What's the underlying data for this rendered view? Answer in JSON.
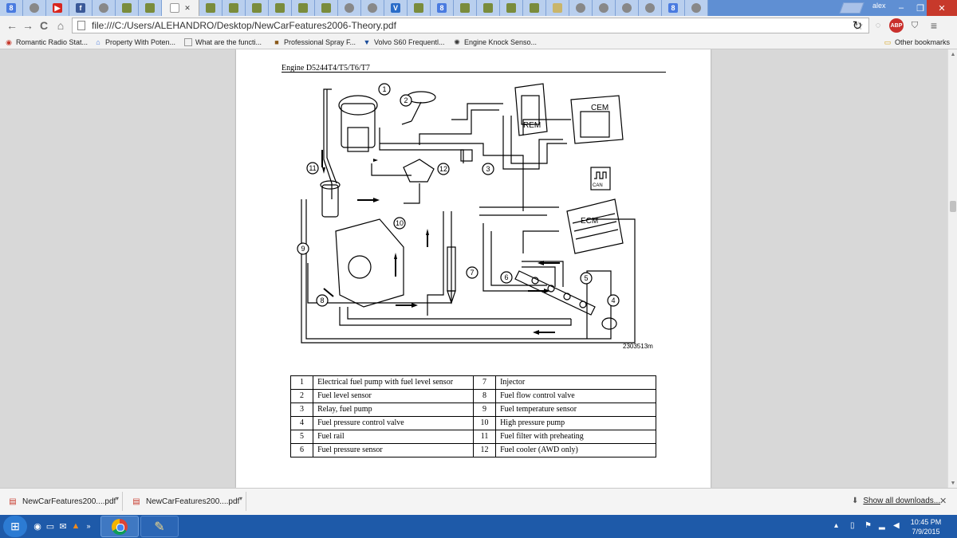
{
  "tabs": [
    {
      "icon": "google-icon",
      "glyph": "8",
      "cls": "g"
    },
    {
      "icon": "globe-icon",
      "glyph": "",
      "cls": "glob"
    },
    {
      "icon": "youtube-icon",
      "glyph": "▶",
      "cls": "yt"
    },
    {
      "icon": "facebook-icon",
      "glyph": "f",
      "cls": "fb"
    },
    {
      "icon": "globe-icon",
      "glyph": "",
      "cls": "glob"
    },
    {
      "icon": "image-icon",
      "glyph": "",
      "cls": "img"
    },
    {
      "icon": "image-icon",
      "glyph": "",
      "cls": "img"
    },
    {
      "icon": "document-icon",
      "glyph": "",
      "cls": "doc",
      "active": true,
      "close": "✕"
    },
    {
      "icon": "image-icon",
      "glyph": "",
      "cls": "img"
    },
    {
      "icon": "image-icon",
      "glyph": "",
      "cls": "img"
    },
    {
      "icon": "image-icon",
      "glyph": "",
      "cls": "img"
    },
    {
      "icon": "image-icon",
      "glyph": "",
      "cls": "img"
    },
    {
      "icon": "image-icon",
      "glyph": "",
      "cls": "img"
    },
    {
      "icon": "image-icon",
      "glyph": "",
      "cls": "img"
    },
    {
      "icon": "globe-icon",
      "glyph": "",
      "cls": "glob"
    },
    {
      "icon": "globe-icon",
      "glyph": "",
      "cls": "glob"
    },
    {
      "icon": "v-icon",
      "glyph": "V",
      "cls": "v"
    },
    {
      "icon": "image-icon",
      "glyph": "",
      "cls": "img"
    },
    {
      "icon": "google-icon",
      "glyph": "8",
      "cls": "g"
    },
    {
      "icon": "image-icon",
      "glyph": "",
      "cls": "img"
    },
    {
      "icon": "image-icon",
      "glyph": "",
      "cls": "img"
    },
    {
      "icon": "image-icon",
      "glyph": "",
      "cls": "img"
    },
    {
      "icon": "image-icon",
      "glyph": "",
      "cls": "img"
    },
    {
      "icon": "mail-icon",
      "glyph": "",
      "cls": "mail"
    },
    {
      "icon": "globe-icon",
      "glyph": "",
      "cls": "glob"
    },
    {
      "icon": "globe-icon",
      "glyph": "",
      "cls": "glob"
    },
    {
      "icon": "globe-icon",
      "glyph": "",
      "cls": "glob"
    },
    {
      "icon": "globe-icon",
      "glyph": "",
      "cls": "glob"
    },
    {
      "icon": "google-icon",
      "glyph": "8",
      "cls": "g"
    },
    {
      "icon": "globe-icon",
      "glyph": "",
      "cls": "glob"
    }
  ],
  "window": {
    "user": "alex",
    "minimize": "–",
    "maximize": "❐",
    "close": "✕"
  },
  "toolbar": {
    "back": "←",
    "forward": "→",
    "reload": "C",
    "home": "⌂",
    "url": "file:///C:/Users/ALEHANDRO/Desktop/NewCarFeatures2006-Theory.pdf",
    "star": "☆",
    "sync": "↻",
    "abp": "ABP",
    "menu": "≡"
  },
  "bookmarks": [
    {
      "label": "Romantic Radio Stat...",
      "icon": "radio-icon",
      "cls": "radio",
      "glyph": "◉"
    },
    {
      "label": "Property With Poten...",
      "icon": "house-icon",
      "cls": "house",
      "glyph": "⌂"
    },
    {
      "label": "What are the functi...",
      "icon": "document-icon",
      "cls": "doc",
      "glyph": ""
    },
    {
      "label": "Professional Spray F...",
      "icon": "shop-icon",
      "cls": "shop",
      "glyph": "■"
    },
    {
      "label": "Volvo S60 Frequentl...",
      "icon": "volvo-icon",
      "cls": "volvo",
      "glyph": "▼"
    },
    {
      "label": "Engine Knock Senso...",
      "icon": "gear-icon",
      "cls": "gear",
      "glyph": "✺"
    }
  ],
  "other_bookmarks": "Other bookmarks",
  "document": {
    "header": "Engine D5244T4/T5/T6/T7",
    "figure_id": "2303513m",
    "diagram_labels": {
      "rem": "REM",
      "cem": "CEM",
      "ecm": "ECM",
      "can": "CAN",
      "callouts": [
        "1",
        "2",
        "3",
        "4",
        "5",
        "6",
        "7",
        "8",
        "9",
        "10",
        "11",
        "12"
      ]
    },
    "legend": [
      {
        "n1": "1",
        "t1": "Electrical fuel pump with fuel level sensor",
        "n2": "7",
        "t2": "Injector"
      },
      {
        "n1": "2",
        "t1": "Fuel level sensor",
        "n2": "8",
        "t2": "Fuel flow control valve"
      },
      {
        "n1": "3",
        "t1": "Relay, fuel pump",
        "n2": "9",
        "t2": "Fuel temperature sensor"
      },
      {
        "n1": "4",
        "t1": "Fuel pressure control valve",
        "n2": "10",
        "t2": "High pressure pump"
      },
      {
        "n1": "5",
        "t1": "Fuel rail",
        "n2": "11",
        "t2": "Fuel filter with preheating"
      },
      {
        "n1": "6",
        "t1": "Fuel pressure sensor",
        "n2": "12",
        "t2": "Fuel cooler (AWD only)"
      }
    ]
  },
  "downloads": [
    {
      "name": "NewCarFeatures200....pdf"
    },
    {
      "name": "NewCarFeatures200....pdf"
    }
  ],
  "show_all": "Show all downloads...",
  "taskbar": {
    "time": "10:45 PM",
    "date": "7/9/2015"
  }
}
